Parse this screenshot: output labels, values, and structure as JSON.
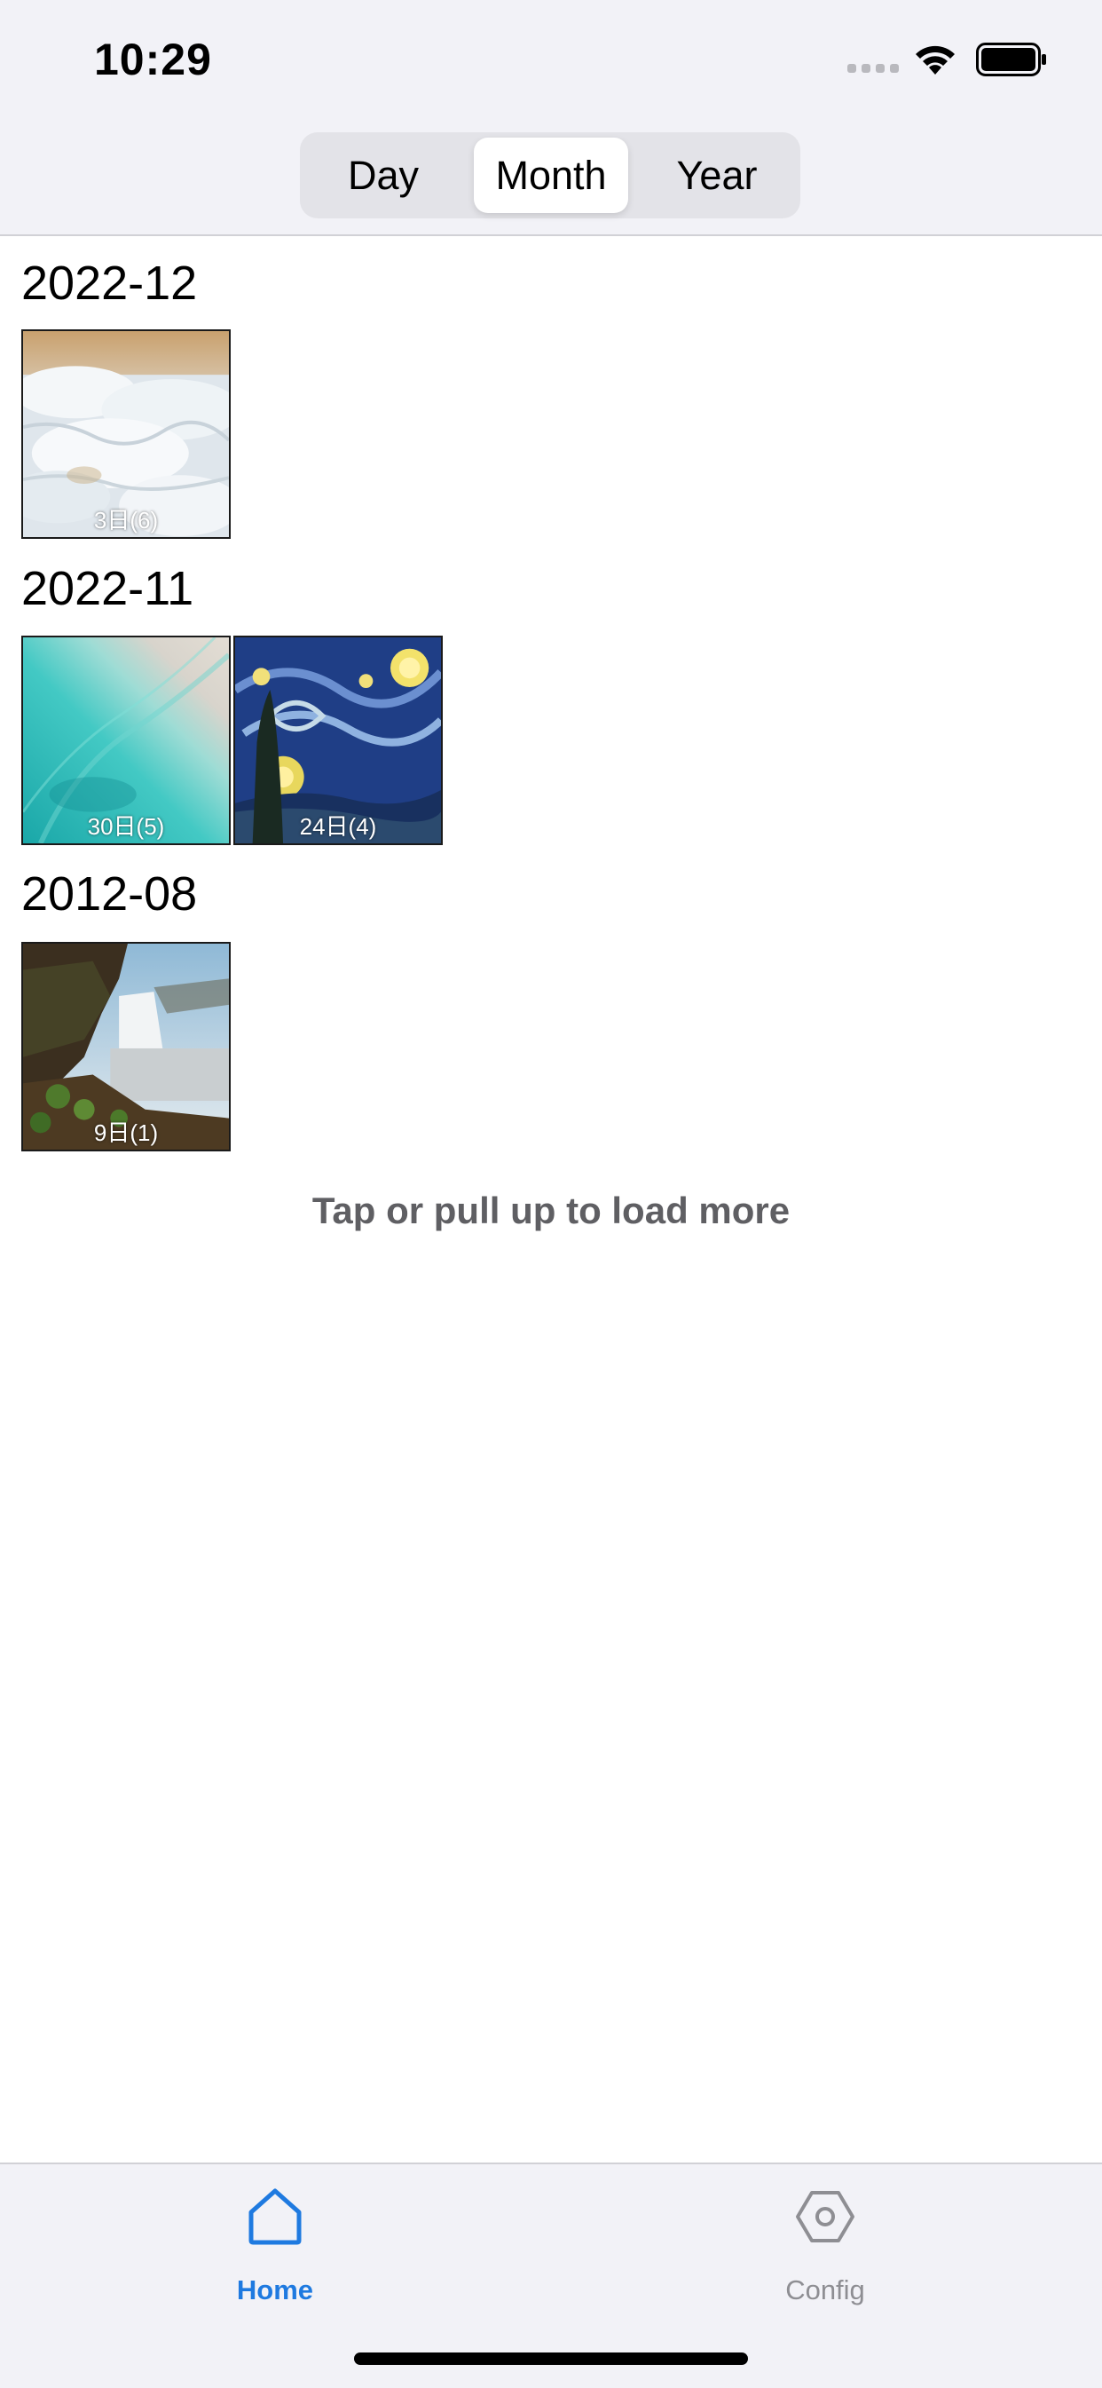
{
  "status_bar": {
    "time": "10:29"
  },
  "segmented_control": {
    "options": [
      "Day",
      "Month",
      "Year"
    ],
    "selected": "Month"
  },
  "sections": [
    {
      "title": "2022-12",
      "items": [
        {
          "caption": "3日(6)",
          "image": "surf-foam"
        }
      ]
    },
    {
      "title": "2022-11",
      "items": [
        {
          "caption": "30日(5)",
          "image": "turquoise-water"
        },
        {
          "caption": "24日(4)",
          "image": "starry-night-painting"
        }
      ]
    },
    {
      "title": "2012-08",
      "items": [
        {
          "caption": "9日(1)",
          "image": "waterfall-landscape"
        }
      ]
    }
  ],
  "load_more": "Tap or pull up to load more",
  "tab_bar": {
    "items": [
      {
        "label": "Home",
        "icon": "house-icon",
        "active": true
      },
      {
        "label": "Config",
        "icon": "hexagon-gear-icon",
        "active": false
      }
    ]
  },
  "colors": {
    "accent": "#1f7ae0",
    "inactive": "#8e8e93",
    "chrome_bg": "#f2f2f7"
  }
}
